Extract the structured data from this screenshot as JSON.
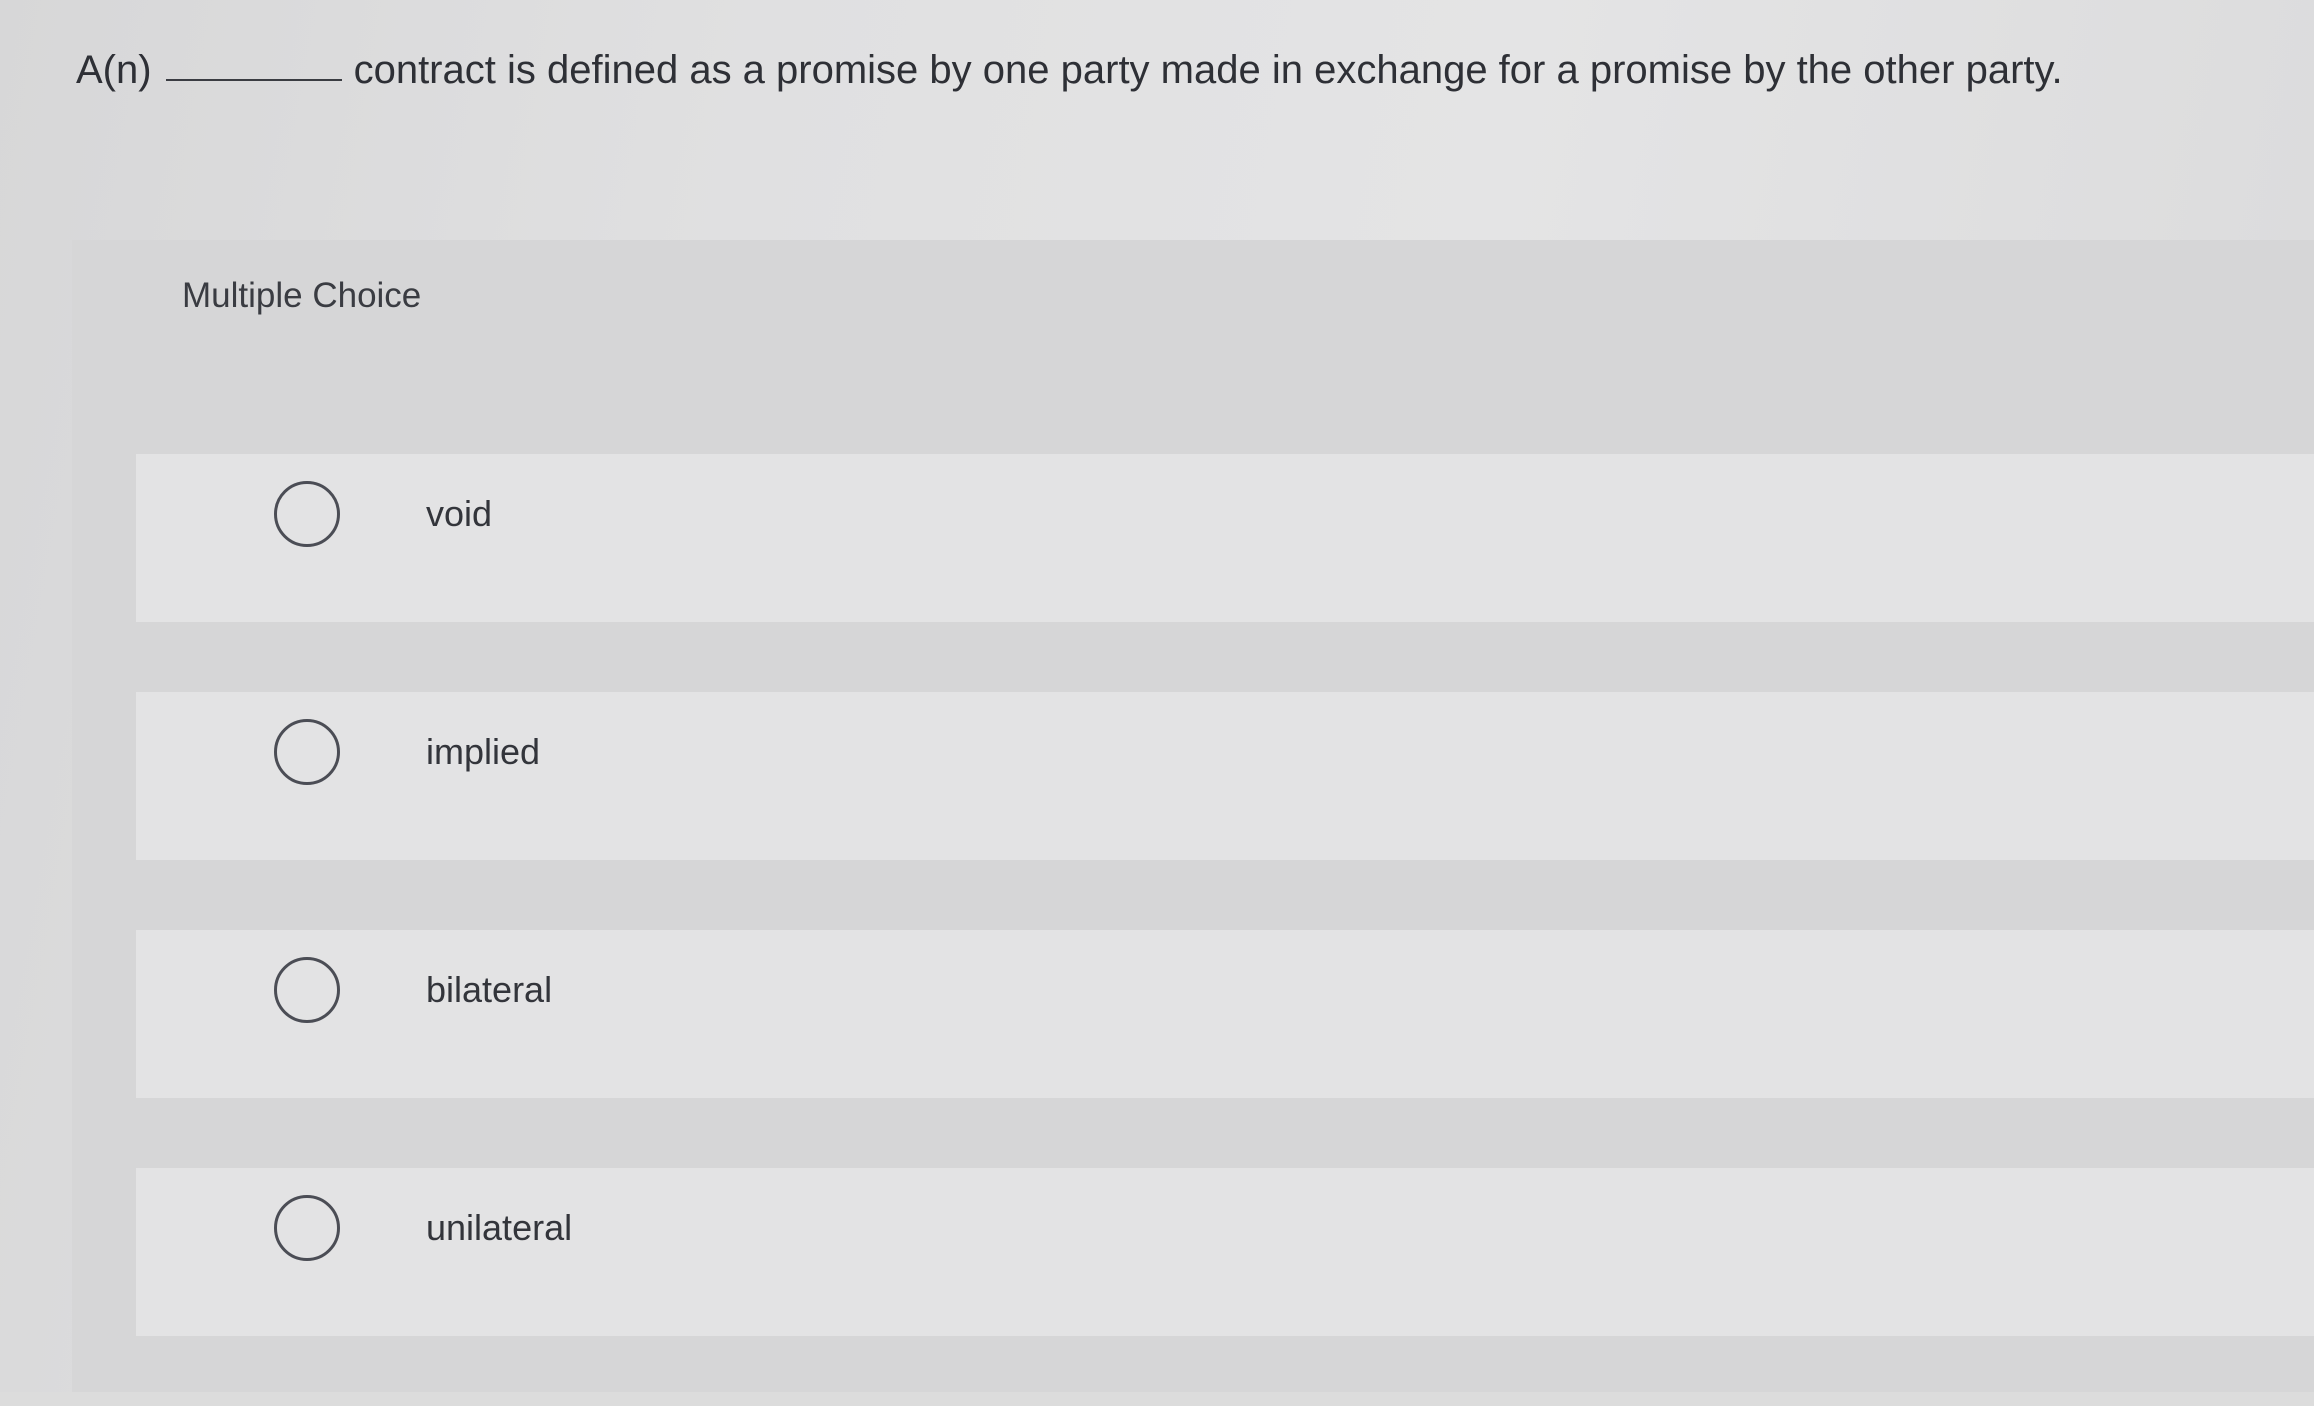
{
  "question": {
    "prefix": "A(n)",
    "suffix": "contract is defined as a promise by one party made in exchange for a promise by the other party."
  },
  "panel": {
    "title": "Multiple Choice",
    "options": [
      {
        "label": "void",
        "selected": false
      },
      {
        "label": "implied",
        "selected": false
      },
      {
        "label": "bilateral",
        "selected": false
      },
      {
        "label": "unilateral",
        "selected": false
      }
    ]
  }
}
